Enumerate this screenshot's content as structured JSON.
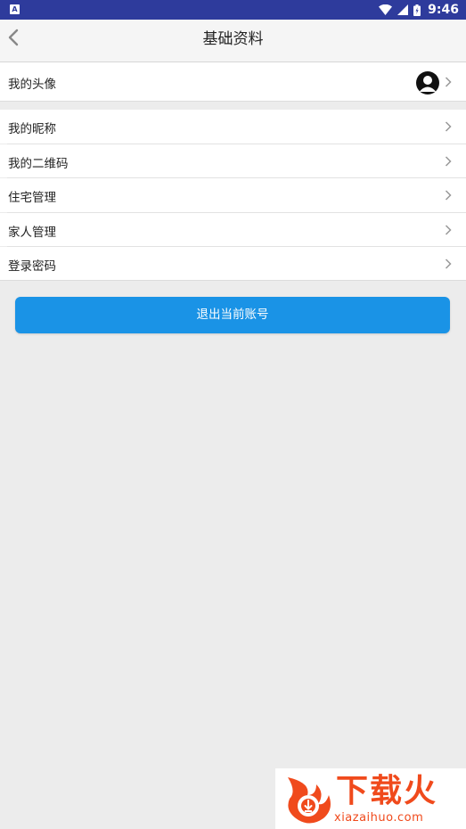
{
  "status_bar": {
    "app_badge": "A",
    "time": "9:46"
  },
  "header": {
    "title": "基础资料"
  },
  "profile": {
    "avatar_label": "我的头像"
  },
  "menu": {
    "items": [
      {
        "label": "我的昵称"
      },
      {
        "label": "我的二维码"
      },
      {
        "label": "住宅管理"
      },
      {
        "label": "家人管理"
      },
      {
        "label": "登录密码"
      }
    ]
  },
  "logout": {
    "label": "退出当前账号"
  },
  "watermark": {
    "main": "下载火",
    "sub": "xiazaihuo.com"
  },
  "colors": {
    "status_bar": "#2e3b9c",
    "accent_button": "#1a93e6",
    "background": "#ececec",
    "watermark": "#f04a1c"
  }
}
